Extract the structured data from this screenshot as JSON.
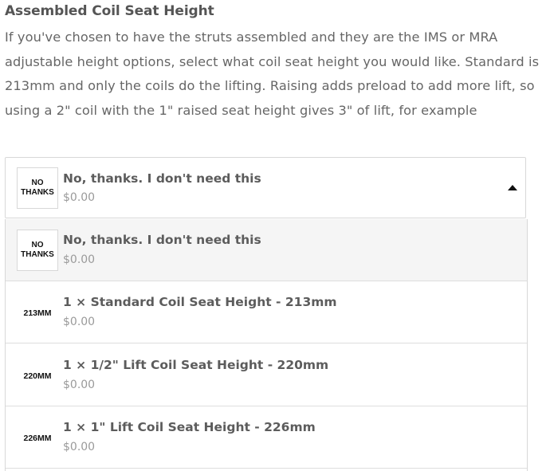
{
  "heading": "Assembled Coil Seat Height",
  "description": "If you've chosen to have the struts assembled and they are the IMS or MRA adjustable height options, select what coil seat height you would like. Standard is 213mm and only the coils do the lifting. Raising adds preload to add more lift, so using a 2\" coil with the 1\" raised seat height gives 3\" of lift, for example",
  "selected": {
    "thumb_line1": "NO",
    "thumb_line2": "THANKS",
    "name": "No, thanks. I don't need this",
    "price": "$0.00"
  },
  "options": [
    {
      "thumb_line1": "NO",
      "thumb_line2": "THANKS",
      "name": "No, thanks. I don't need this",
      "price": "$0.00"
    },
    {
      "thumb_line1": "213mm",
      "thumb_line2": "",
      "name": "1 × Standard Coil Seat Height - 213mm",
      "price": "$0.00"
    },
    {
      "thumb_line1": "220mm",
      "thumb_line2": "",
      "name": "1 × 1/2\" Lift Coil Seat Height - 220mm",
      "price": "$0.00"
    },
    {
      "thumb_line1": "226mm",
      "thumb_line2": "",
      "name": "1 × 1\" Lift Coil Seat Height - 226mm",
      "price": "$0.00"
    }
  ]
}
